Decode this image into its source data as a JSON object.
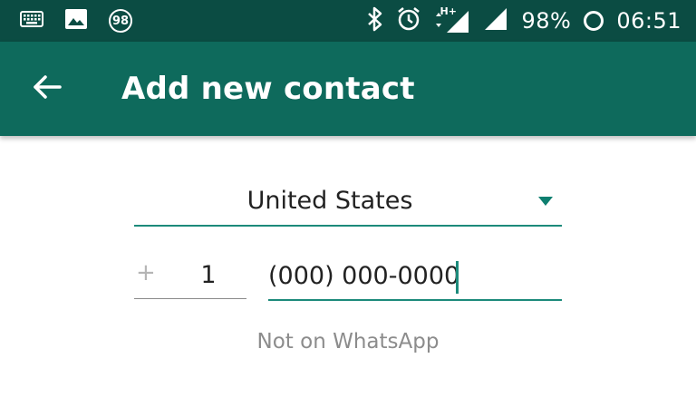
{
  "status_bar": {
    "notification_badge": "98",
    "battery_percent": "98%",
    "time": "06:51",
    "icons": [
      "keyboard-icon",
      "image-icon",
      "bluetooth-icon",
      "alarm-icon",
      "mobile-data-icon",
      "signal-icon",
      "battery-ring-icon"
    ],
    "network_type": "H+"
  },
  "toolbar": {
    "title": "Add new contact",
    "back_icon": "arrow-left-icon",
    "background_color": "#0e6a5c"
  },
  "form": {
    "country": "United States",
    "plus_sign": "+",
    "country_code": "1",
    "phone_placeholder": "(000) 000-0000",
    "phone_value": "",
    "note": "Not on WhatsApp"
  },
  "colors": {
    "accent": "#1c8a7b",
    "status_bar": "#0b4c43"
  }
}
